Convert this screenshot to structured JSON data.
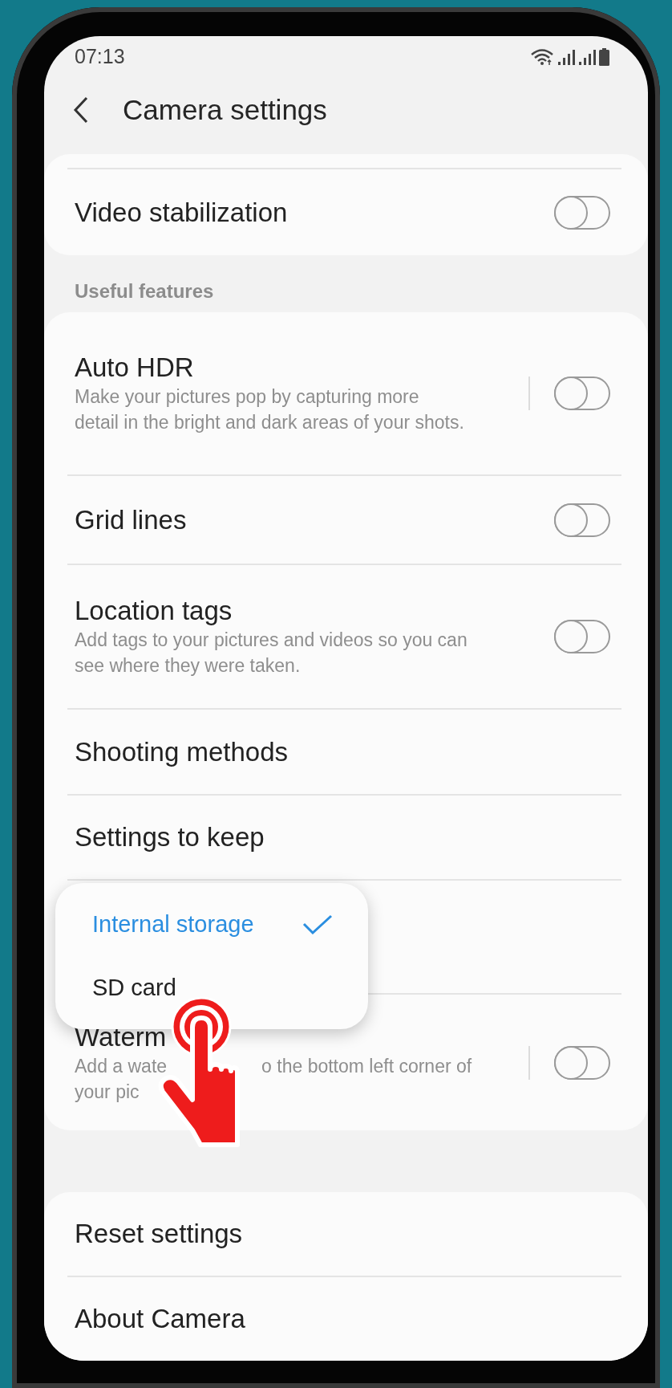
{
  "status_bar": {
    "time": "07:13"
  },
  "header": {
    "title": "Camera settings"
  },
  "cards": [
    {
      "items": [
        {
          "kind": "toggle",
          "title": "Video stabilization",
          "on": false
        }
      ]
    },
    {
      "heading": "Useful features",
      "items": [
        {
          "kind": "toggle_split",
          "title": "Auto HDR",
          "description": "Make your pictures pop by capturing more detail in the bright and dark areas of your shots.",
          "on": false
        },
        {
          "kind": "toggle",
          "title": "Grid lines",
          "on": false
        },
        {
          "kind": "toggle",
          "title": "Location tags",
          "description": "Add tags to your pictures and videos so you can see where they were taken.",
          "on": false
        },
        {
          "kind": "link",
          "title": "Shooting methods"
        },
        {
          "kind": "link",
          "title": "Settings to keep"
        },
        {
          "kind": "covered"
        },
        {
          "kind": "toggle_split",
          "title": "Waterm",
          "description_lines": [
            [
              "Add a wate",
              "o the bottom left corner of"
            ],
            [
              "your pic"
            ]
          ],
          "on": false
        }
      ]
    },
    {
      "items": [
        {
          "kind": "link",
          "title": "Reset settings"
        },
        {
          "kind": "link",
          "title": "About Camera"
        }
      ]
    }
  ],
  "popup": {
    "options": [
      {
        "label": "Internal storage",
        "selected": true
      },
      {
        "label": "SD card",
        "selected": false
      }
    ]
  }
}
